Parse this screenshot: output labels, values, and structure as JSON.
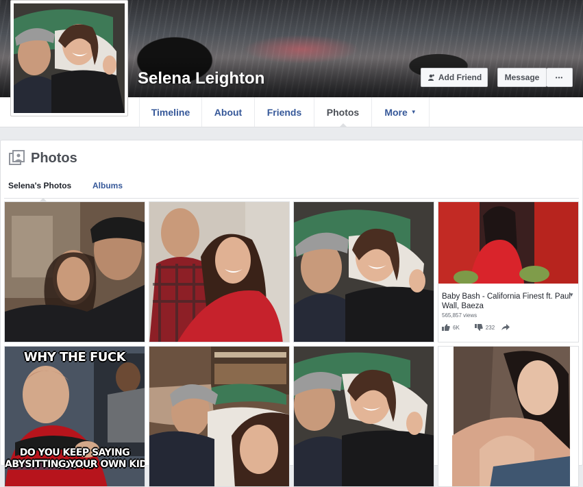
{
  "profile": {
    "name": "Selena Leighton",
    "add_friend_label": "Add Friend",
    "message_label": "Message",
    "more_dots": "•••"
  },
  "nav": {
    "tabs": [
      {
        "label": "Timeline"
      },
      {
        "label": "About"
      },
      {
        "label": "Friends"
      },
      {
        "label": "Photos"
      },
      {
        "label": "More"
      }
    ],
    "more_caret": "▼"
  },
  "photos_section": {
    "title": "Photos",
    "subtabs": [
      "Selena's Photos",
      "Albums"
    ]
  },
  "video": {
    "title": "Baby Bash - California Finest ft. Paul Wall, Baeza",
    "views": "565,857 views",
    "likes": "6K",
    "dislikes": "232",
    "menu_caret": "▼"
  },
  "meme": {
    "top_text": "WHY THE FUCK",
    "bottom_text_line1": "DO YOU KEEP SAYING YOU'RE",
    "bottom_text_line2": "ABYSITTING YOUR OWN KIDS? IT"
  },
  "colors": {
    "link": "#365899",
    "page_bg": "#e9ebee",
    "border": "#dddfe2"
  }
}
